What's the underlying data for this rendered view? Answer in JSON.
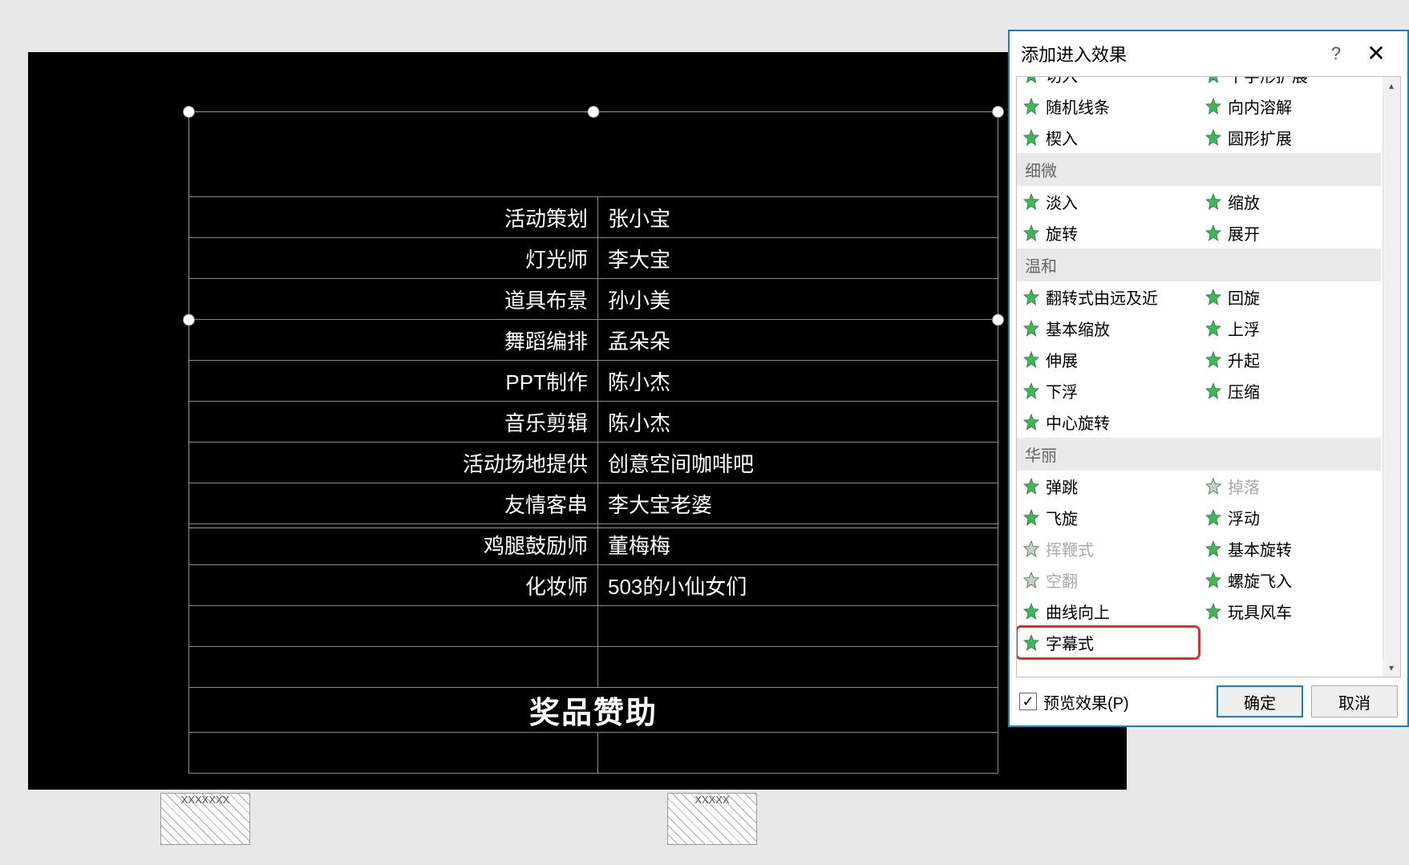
{
  "dialog": {
    "title": "添加进入效果",
    "help": "?",
    "close": "✕",
    "preview_label": "预览效果(P)",
    "ok": "确定",
    "cancel": "取消"
  },
  "groups": [
    {
      "items": [
        {
          "label": "切入",
          "partial": true
        },
        {
          "label": "十字形扩展",
          "partial": true
        },
        {
          "label": "随机线条"
        },
        {
          "label": "向内溶解"
        },
        {
          "label": "楔入"
        },
        {
          "label": "圆形扩展"
        }
      ]
    },
    {
      "header": "细微",
      "items": [
        {
          "label": "淡入"
        },
        {
          "label": "缩放"
        },
        {
          "label": "旋转"
        },
        {
          "label": "展开"
        }
      ]
    },
    {
      "header": "温和",
      "items": [
        {
          "label": "翻转式由远及近"
        },
        {
          "label": "回旋"
        },
        {
          "label": "基本缩放"
        },
        {
          "label": "上浮"
        },
        {
          "label": "伸展"
        },
        {
          "label": "升起"
        },
        {
          "label": "下浮"
        },
        {
          "label": "压缩"
        },
        {
          "label": "中心旋转"
        }
      ]
    },
    {
      "header": "华丽",
      "items": [
        {
          "label": "弹跳"
        },
        {
          "label": "掉落",
          "disabled": true
        },
        {
          "label": "飞旋"
        },
        {
          "label": "浮动"
        },
        {
          "label": "挥鞭式",
          "disabled": true
        },
        {
          "label": "基本旋转"
        },
        {
          "label": "空翻",
          "disabled": true
        },
        {
          "label": "螺旋飞入"
        },
        {
          "label": "曲线向上"
        },
        {
          "label": "玩具风车"
        },
        {
          "label": "字幕式",
          "highlighted": true
        }
      ]
    }
  ],
  "credits": [
    {
      "role": "活动策划",
      "name": "张小宝"
    },
    {
      "role": "灯光师",
      "name": "李大宝"
    },
    {
      "role": "道具布景",
      "name": "孙小美"
    },
    {
      "role": "舞蹈编排",
      "name": "孟朵朵"
    },
    {
      "role": "PPT制作",
      "name": "陈小杰"
    },
    {
      "role": "音乐剪辑",
      "name": "陈小杰"
    },
    {
      "role": "活动场地提供",
      "name": "创意空间咖啡吧"
    },
    {
      "role": "友情客串",
      "name": "李大宝老婆"
    },
    {
      "role": "鸡腿鼓励师",
      "name": "董梅梅"
    },
    {
      "role": "化妆师",
      "name": "503的小仙女们"
    }
  ],
  "title_row": "奖品赞助",
  "thumbs": [
    "XXXXXXX",
    "XXXXX"
  ]
}
